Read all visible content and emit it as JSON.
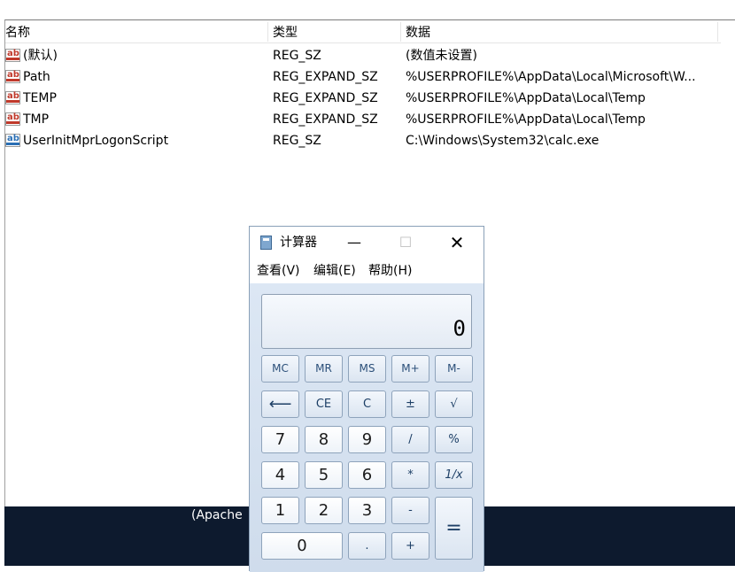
{
  "registry": {
    "columns": [
      "名称",
      "类型",
      "数据"
    ],
    "rows": [
      {
        "name": "(默认)",
        "type": "REG_SZ",
        "data": "(数值未设置)",
        "icon": "string-value-icon"
      },
      {
        "name": "Path",
        "type": "REG_EXPAND_SZ",
        "data": "%USERPROFILE%\\AppData\\Local\\Microsoft\\W...",
        "icon": "string-value-icon"
      },
      {
        "name": "TEMP",
        "type": "REG_EXPAND_SZ",
        "data": "%USERPROFILE%\\AppData\\Local\\Temp",
        "icon": "string-value-icon"
      },
      {
        "name": "TMP",
        "type": "REG_EXPAND_SZ",
        "data": "%USERPROFILE%\\AppData\\Local\\Temp",
        "icon": "string-value-icon"
      },
      {
        "name": "UserInitMprLogonScript",
        "type": "REG_SZ",
        "data": "C:\\Windows\\System32\\calc.exe",
        "icon": "string-value-icon"
      }
    ]
  },
  "taskbar": {
    "text": "(Apache"
  },
  "calculator": {
    "title": "计算器",
    "window_buttons": {
      "minimize": "—",
      "maximize": "☐",
      "close": "✕"
    },
    "menu": [
      "查看(V)",
      "编辑(E)",
      "帮助(H)"
    ],
    "display": "0",
    "keys": {
      "mc": "MC",
      "mr": "MR",
      "ms": "MS",
      "mplus": "M+",
      "mminus": "M-",
      "backspace": "⟵",
      "ce": "CE",
      "c": "C",
      "plusminus": "±",
      "sqrt": "√",
      "seven": "7",
      "eight": "8",
      "nine": "9",
      "divide": "/",
      "percent": "%",
      "four": "4",
      "five": "5",
      "six": "6",
      "multiply": "*",
      "reciprocal": "1/x",
      "one": "1",
      "two": "2",
      "three": "3",
      "minus": "-",
      "equals": "=",
      "zero": "0",
      "dot": ".",
      "plus": "+"
    }
  }
}
